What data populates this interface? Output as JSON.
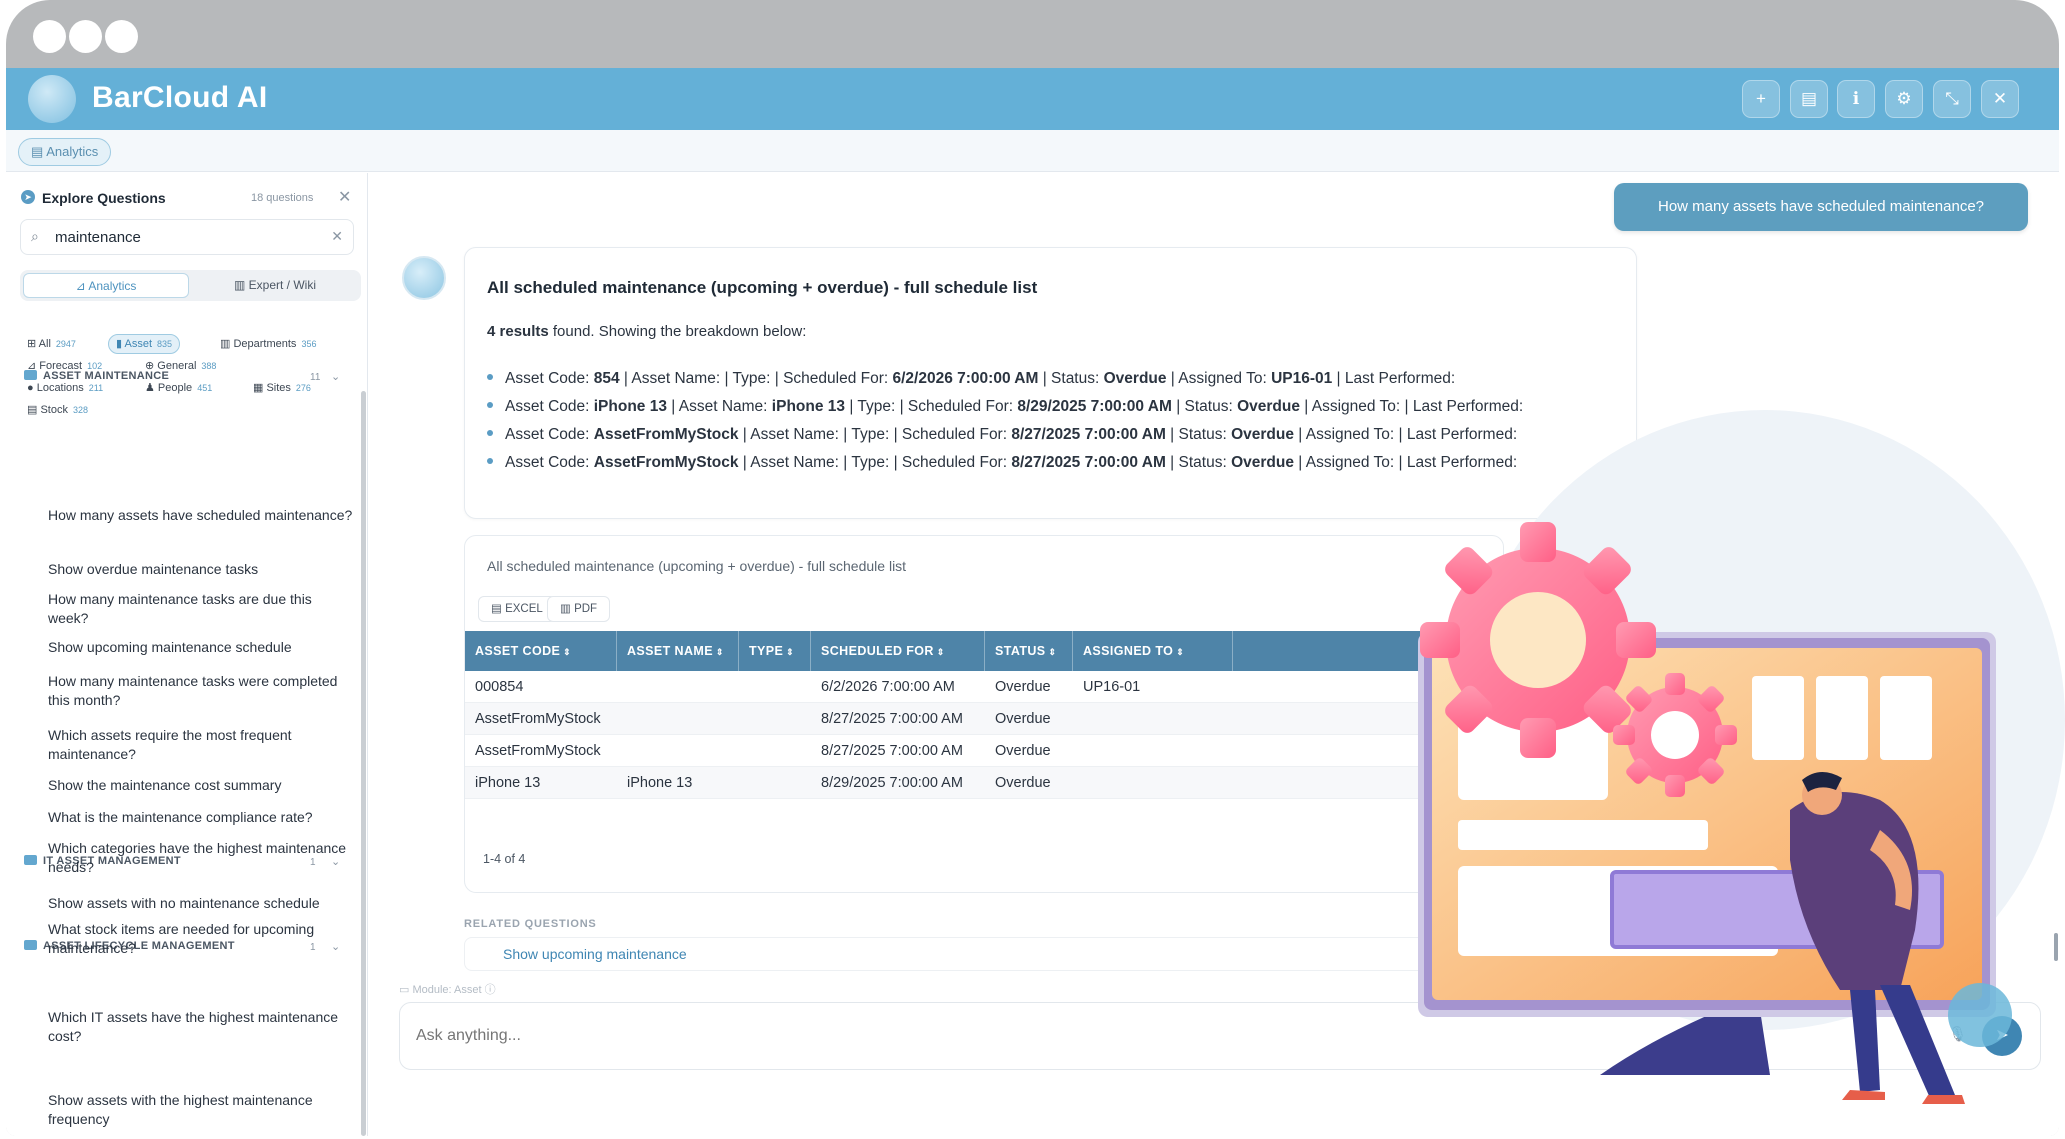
{
  "app": {
    "title": "BarCloud AI"
  },
  "header_buttons": [
    {
      "name": "plus-icon",
      "glyph": "+"
    },
    {
      "name": "book-icon",
      "glyph": "▤"
    },
    {
      "name": "info-icon",
      "glyph": "ℹ"
    },
    {
      "name": "gear-icon",
      "glyph": "⚙"
    },
    {
      "name": "collapse-icon",
      "glyph": "⤡"
    },
    {
      "name": "close-icon",
      "glyph": "✕"
    }
  ],
  "chip_row": {
    "analytics_label": "Analytics"
  },
  "sidebar": {
    "title": "Explore Questions",
    "count": "18 questions",
    "search_value": "maintenance",
    "mode_tabs": [
      "Analytics",
      "Expert / Wiki"
    ],
    "filters": [
      {
        "label": "All",
        "count": "2947"
      },
      {
        "label": "Asset",
        "count": "835"
      },
      {
        "label": "Departments",
        "count": "356"
      },
      {
        "label": "Forecast",
        "count": "102"
      },
      {
        "label": "General",
        "count": "388"
      },
      {
        "label": "Locations",
        "count": "211"
      },
      {
        "label": "People",
        "count": "451"
      },
      {
        "label": "Sites",
        "count": "276"
      },
      {
        "label": "Stock",
        "count": "328"
      }
    ],
    "categories": [
      {
        "label": "ASSET MAINTENANCE",
        "count": "11"
      },
      {
        "label": "IT ASSET MANAGEMENT",
        "count": "1"
      },
      {
        "label": "ASSET LIFECYCLE MANAGEMENT",
        "count": "1"
      }
    ],
    "questions": [
      "How many assets have scheduled maintenance?",
      "Show overdue maintenance tasks",
      "How many maintenance tasks are due this week?",
      "Show upcoming maintenance schedule",
      "How many maintenance tasks were completed this month?",
      "Which assets require the most frequent maintenance?",
      "Show the maintenance cost summary",
      "What is the maintenance compliance rate?",
      "Which categories have the highest maintenance needs?",
      "Show assets with no maintenance schedule",
      "What stock items are needed for upcoming maintenance?",
      "Which IT assets have the highest maintenance cost?",
      "Show assets with the highest maintenance frequency"
    ]
  },
  "chat": {
    "user_message": "How many assets have scheduled maintenance?",
    "answer": {
      "title": "All scheduled maintenance (upcoming + overdue) - full schedule list",
      "summary_count": "4 results",
      "summary_rest": " found. Showing the breakdown below:",
      "lines": [
        {
          "code": "854",
          "name": "",
          "sched": "6/2/2026 7:00:00 AM",
          "status": "Overdue",
          "assigned": "UP16-01"
        },
        {
          "code": "iPhone 13",
          "name": "iPhone 13",
          "sched": "8/29/2025 7:00:00 AM",
          "status": "Overdue",
          "assigned": ""
        },
        {
          "code": "AssetFromMyStock",
          "name": "",
          "sched": "8/27/2025 7:00:00 AM",
          "status": "Overdue",
          "assigned": ""
        },
        {
          "code": "AssetFromMyStock",
          "name": "",
          "sched": "8/27/2025 7:00:00 AM",
          "status": "Overdue",
          "assigned": ""
        }
      ],
      "labels": {
        "code": "Asset Code: ",
        "name": " | Asset Name: ",
        "type": " | Type: ",
        "sched": " | Scheduled For: ",
        "status": " | Status: ",
        "assigned": " | Assigned To: ",
        "last": " | Last Performed:"
      }
    },
    "table": {
      "title": "All scheduled maintenance (upcoming + overdue) - full schedule list",
      "export_excel": "EXCEL",
      "export_pdf": "PDF",
      "columns": [
        "ASSET CODE",
        "ASSET NAME",
        "TYPE",
        "SCHEDULED FOR",
        "STATUS",
        "ASSIGNED TO"
      ],
      "rows": [
        [
          "000854",
          "",
          "",
          "6/2/2026 7:00:00 AM",
          "Overdue",
          "UP16-01"
        ],
        [
          "AssetFromMyStock",
          "",
          "",
          "8/27/2025 7:00:00 AM",
          "Overdue",
          ""
        ],
        [
          "AssetFromMyStock",
          "",
          "",
          "8/27/2025 7:00:00 AM",
          "Overdue",
          ""
        ],
        [
          "iPhone 13",
          "iPhone 13",
          "",
          "8/29/2025 7:00:00 AM",
          "Overdue",
          ""
        ]
      ],
      "pager": "1-4 of 4"
    },
    "related_label": "RELATED QUESTIONS",
    "related_questions": [
      "Show upcoming maintenance"
    ],
    "module_label": "Module: Asset",
    "input_placeholder": "Ask anything..."
  },
  "colors": {
    "header": "#64b0d7",
    "accent": "#3f86b3",
    "table_header": "#4e84a8",
    "user_bubble": "#5d9ebf"
  }
}
